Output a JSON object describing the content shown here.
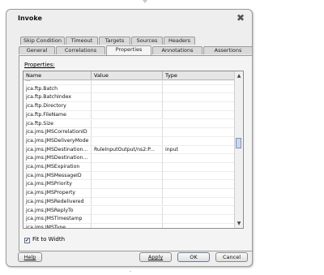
{
  "dialog": {
    "title": "Invoke",
    "close_glyph": "✖"
  },
  "tabs_row1": [
    "Skip Condition",
    "Timeout",
    "Targets",
    "Sources",
    "Headers"
  ],
  "tabs_row2": [
    "General",
    "Correlations",
    "Properties",
    "Annotations",
    "Assertions"
  ],
  "active_tab": "Properties",
  "panel": {
    "label": "Properties:",
    "columns": [
      "Name",
      "Value",
      "Type"
    ],
    "rows": [
      {
        "name": "...",
        "value": "",
        "type": ""
      },
      {
        "name": "jca.ftp.Batch",
        "value": "",
        "type": ""
      },
      {
        "name": "jca.ftp.BatchIndex",
        "value": "",
        "type": ""
      },
      {
        "name": "jca.ftp.Directory",
        "value": "",
        "type": ""
      },
      {
        "name": "jca.ftp.FileName",
        "value": "",
        "type": ""
      },
      {
        "name": "jca.ftp.Size",
        "value": "",
        "type": ""
      },
      {
        "name": "jca.jms.JMSCorrelationID",
        "value": "",
        "type": ""
      },
      {
        "name": "jca.jms.JMSDeliveryMode",
        "value": "",
        "type": ""
      },
      {
        "name": "jca.jms.JMSDestination...",
        "value": "RuleInputOutput/ns2:P...",
        "type": "input"
      },
      {
        "name": "jca.jms.JMSDestination...",
        "value": "",
        "type": ""
      },
      {
        "name": "jca.jms.JMSExpiration",
        "value": "",
        "type": ""
      },
      {
        "name": "jca.jms.JMSMessageID",
        "value": "",
        "type": ""
      },
      {
        "name": "jca.jms.JMSPriority",
        "value": "",
        "type": ""
      },
      {
        "name": "jca.jms.JMSProperty",
        "value": "",
        "type": ""
      },
      {
        "name": "jca.jms.JMSRedelivered",
        "value": "",
        "type": ""
      },
      {
        "name": "jca.jms.JMSReplyTo",
        "value": "",
        "type": ""
      },
      {
        "name": "jca.jms.JMSTimestamp",
        "value": "",
        "type": ""
      },
      {
        "name": "jca.jms.JMSType",
        "value": "",
        "type": ""
      }
    ],
    "fit_to_width": {
      "label": "Fit to Width",
      "checked": true
    }
  },
  "buttons": {
    "help": "Help",
    "apply": "Apply",
    "ok": "OK",
    "cancel": "Cancel"
  },
  "icons": {
    "scroll_up": "up-arrow-icon",
    "scroll_down": "down-arrow-icon",
    "close": "close-icon",
    "check": "checkmark-icon"
  }
}
